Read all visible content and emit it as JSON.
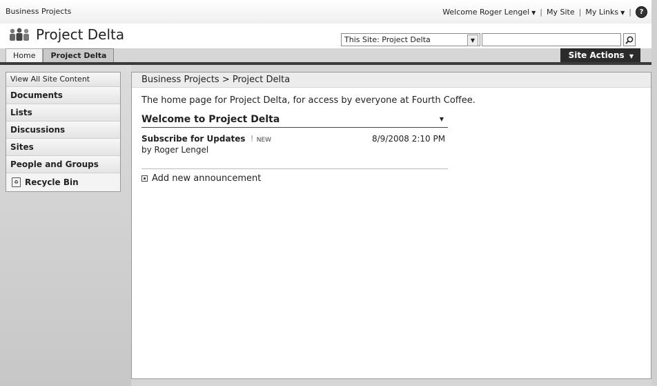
{
  "top_bar": {
    "breadcrumb": "Business Projects",
    "welcome": "Welcome Roger Lengel",
    "my_site": "My Site",
    "my_links": "My Links",
    "separator": "|",
    "help_glyph": "?"
  },
  "site": {
    "title": "Project Delta"
  },
  "search": {
    "scope": "This Site: Project Delta",
    "query": ""
  },
  "tabs": [
    {
      "label": "Home"
    },
    {
      "label": "Project Delta"
    }
  ],
  "site_actions": {
    "label": "Site Actions"
  },
  "quick_launch": {
    "items": [
      {
        "label": "View All Site Content"
      },
      {
        "label": "Documents"
      },
      {
        "label": "Lists"
      },
      {
        "label": "Discussions"
      },
      {
        "label": "Sites"
      },
      {
        "label": "People and Groups"
      }
    ],
    "recycle_bin": "Recycle Bin"
  },
  "main": {
    "breadcrumb": "Business Projects > Project Delta",
    "description": "The home page for Project Delta, for access by everyone at Fourth Coffee.",
    "web_part_title": "Welcome to Project Delta",
    "announcement": {
      "title": "Subscribe for Updates",
      "priority_mark": "!",
      "new_badge": "NEW",
      "date": "8/9/2008 2:10 PM",
      "author": "by Roger Lengel"
    },
    "add_link": "Add new announcement"
  },
  "icons": {
    "site_logo": "people-group-icon",
    "dropdown": "chevron-down-icon",
    "search": "magnifier-icon",
    "recycle": "recycle-bin-icon",
    "help": "help-icon",
    "bullet": "square-bullet-icon"
  }
}
